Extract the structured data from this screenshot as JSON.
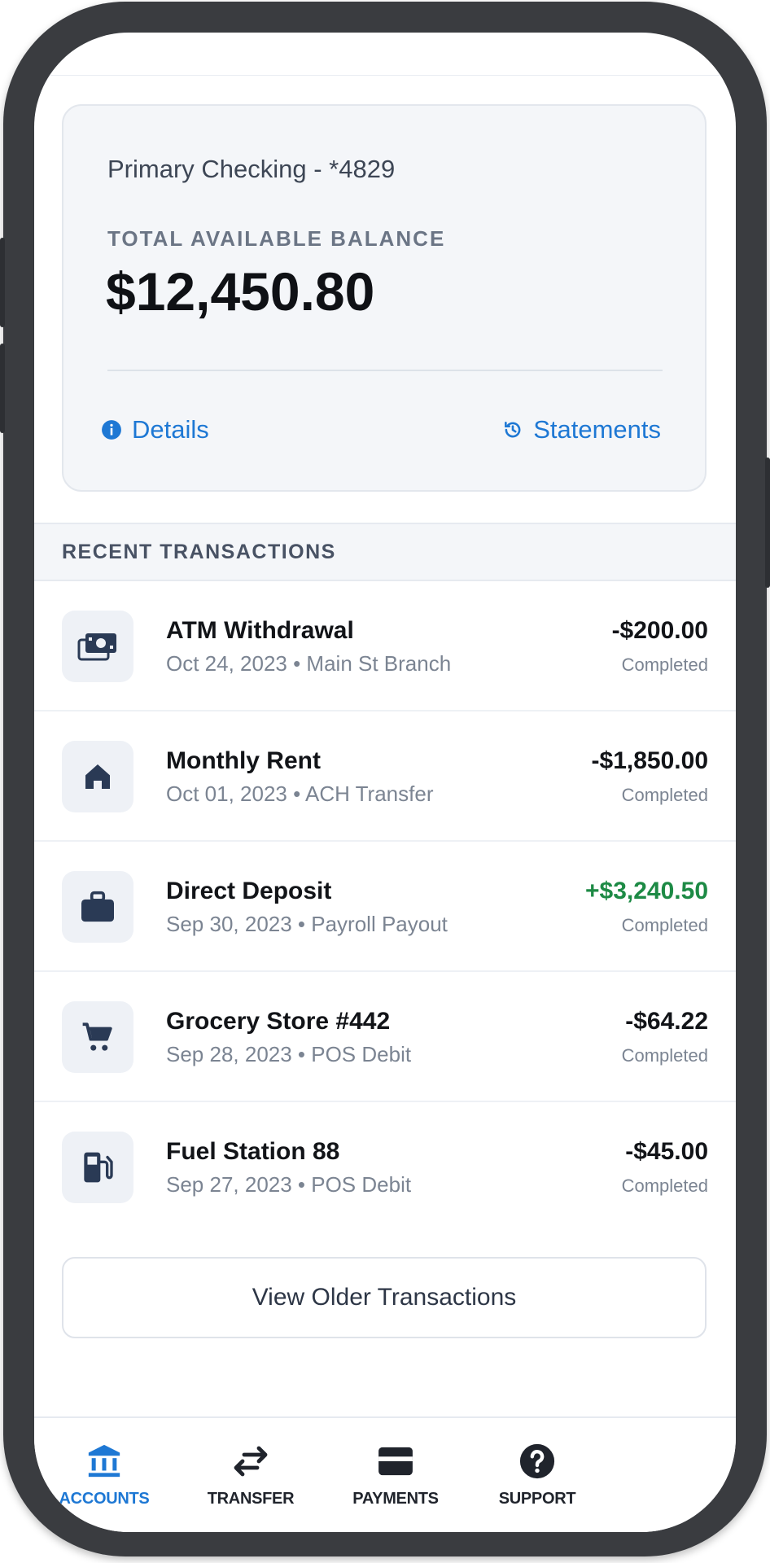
{
  "account": {
    "name": "Primary Checking - *4829",
    "balance_label": "TOTAL AVAILABLE BALANCE",
    "balance": "$12,450.80",
    "details_label": "Details",
    "statements_label": "Statements"
  },
  "recent": {
    "header": "RECENT TRANSACTIONS",
    "items": [
      {
        "title": "ATM Withdrawal",
        "subtitle": "Oct 24, 2023 • Main St Branch",
        "amount": "-$200.00",
        "status": "Completed",
        "icon": "cash-icon"
      },
      {
        "title": "Monthly Rent",
        "subtitle": "Oct 01, 2023 • ACH Transfer",
        "amount": "-$1,850.00",
        "status": "Completed",
        "icon": "home-icon"
      },
      {
        "title": "Direct Deposit",
        "subtitle": "Sep 30, 2023 • Payroll Payout",
        "amount": "+$3,240.50",
        "status": "Completed",
        "icon": "briefcase-icon"
      },
      {
        "title": "Grocery Store #442",
        "subtitle": "Sep 28, 2023 • POS Debit",
        "amount": "-$64.22",
        "status": "Completed",
        "icon": "cart-icon"
      },
      {
        "title": "Fuel Station 88",
        "subtitle": "Sep 27, 2023 • POS Debit",
        "amount": "-$45.00",
        "status": "Completed",
        "icon": "fuel-icon"
      }
    ],
    "older_button": "View Older Transactions"
  },
  "nav": {
    "accounts": "ACCOUNTS",
    "transfer": "TRANSFER",
    "payments": "PAYMENTS",
    "support": "SUPPORT"
  },
  "colors": {
    "accent": "#1e78d4",
    "positive": "#1d8a45",
    "frame": "#3a3c40"
  }
}
